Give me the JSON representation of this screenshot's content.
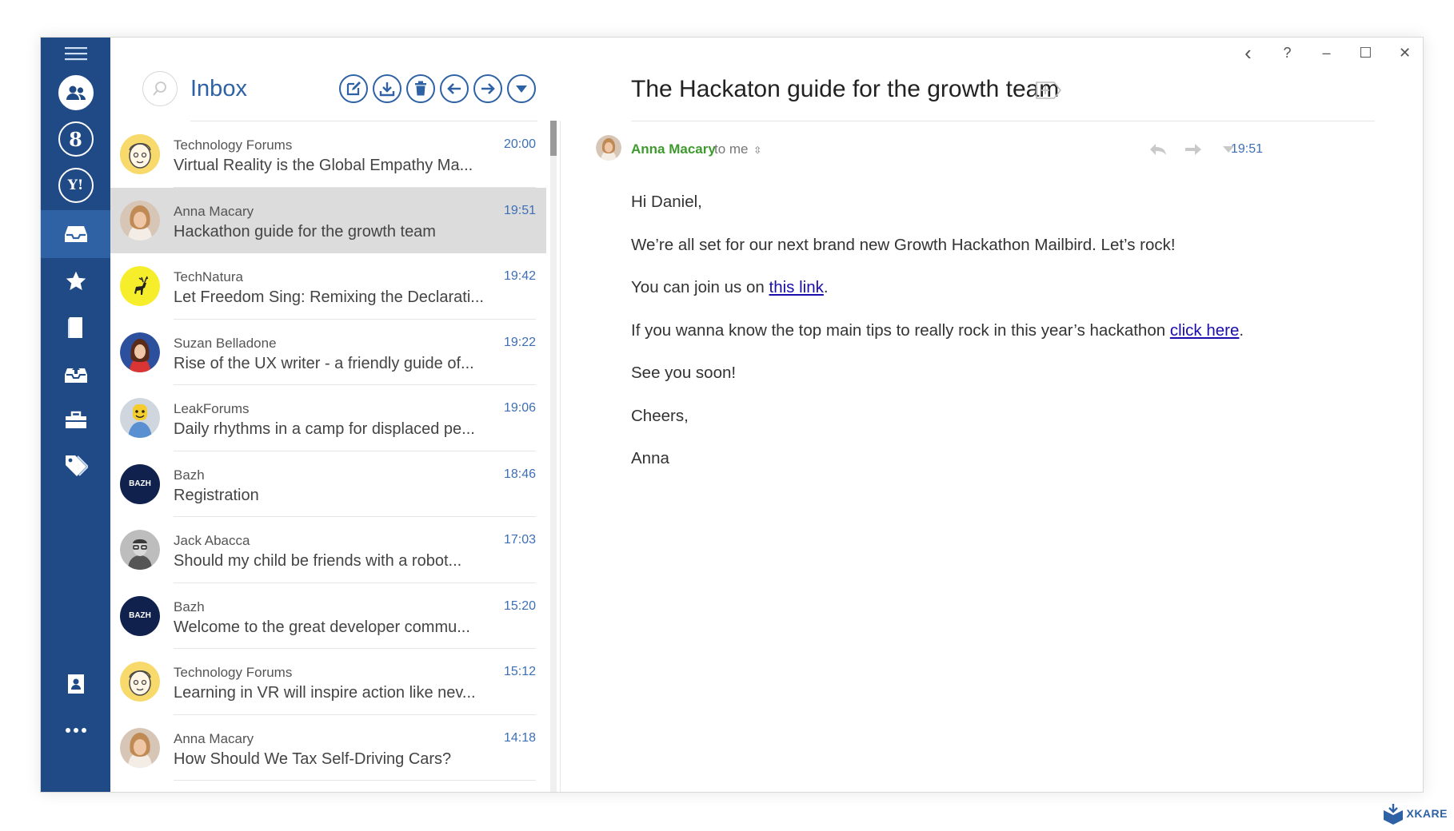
{
  "sidebar": {
    "accounts": [
      {
        "name": "all-accounts",
        "icon": "people-icon"
      },
      {
        "name": "google-account",
        "icon": "google-icon",
        "glyph": "8"
      },
      {
        "name": "yahoo-account",
        "icon": "yahoo-icon",
        "glyph": "Y!"
      }
    ],
    "folders": [
      "inbox",
      "starred",
      "drafts",
      "archive",
      "briefcase",
      "tags"
    ],
    "bottom": [
      "contacts",
      "more"
    ]
  },
  "list": {
    "title": "Inbox",
    "messages": [
      {
        "sender": "Technology Forums",
        "subject": "Virtual Reality is the Global Empathy Ma...",
        "time": "20:00",
        "avatar": "cartoon-face"
      },
      {
        "sender": "Anna Macary",
        "subject": "Hackathon guide for the growth team",
        "time": "19:51",
        "avatar": "woman-photo",
        "selected": true
      },
      {
        "sender": "TechNatura",
        "subject": "Let Freedom Sing: Remixing the Declarati...",
        "time": "19:42",
        "avatar": "deer-logo"
      },
      {
        "sender": "Suzan Belladone",
        "subject": "Rise of the UX writer - a friendly guide of...",
        "time": "19:22",
        "avatar": "woman-blue"
      },
      {
        "sender": "LeakForums",
        "subject": "Daily rhythms in a camp for displaced pe...",
        "time": "19:06",
        "avatar": "lego-figure"
      },
      {
        "sender": "Bazh",
        "subject": "Registration",
        "time": "18:46",
        "avatar": "bazh-logo",
        "avatar_text": "BAZH"
      },
      {
        "sender": "Jack Abacca",
        "subject": "Should my child be friends with a robot...",
        "time": "17:03",
        "avatar": "man-photo"
      },
      {
        "sender": "Bazh",
        "subject": "Welcome to the great developer commu...",
        "time": "15:20",
        "avatar": "bazh-logo",
        "avatar_text": "BAZH"
      },
      {
        "sender": "Technology Forums",
        "subject": "Learning in VR will inspire action like nev...",
        "time": "15:12",
        "avatar": "cartoon-face"
      },
      {
        "sender": "Anna Macary",
        "subject": "How Should We Tax Self-Driving Cars?",
        "time": "14:18",
        "avatar": "woman-photo"
      }
    ]
  },
  "reading": {
    "title": "The Hackaton guide for the growth team",
    "from": "Anna Macary",
    "to": "to me",
    "time": "19:51",
    "body": {
      "greeting": "Hi Daniel,",
      "line1": "We’re all set for our next brand new Growth Hackathon Mailbird. Let’s rock!",
      "line2_pre": "You can join us on ",
      "line2_link": "this link",
      "line2_post": ".",
      "line3_pre": "If you wanna know the top main tips to really rock in this year’s hackathon ",
      "line3_link": "click here",
      "line3_post": ".",
      "line4": "See you soon!",
      "line5": "Cheers,",
      "signature": "Anna"
    }
  },
  "window_controls": {
    "back": "‹",
    "help": "?",
    "minimize": "–",
    "maximize": "☐",
    "close": "✕"
  },
  "watermark": {
    "text": "XKARE"
  },
  "colors": {
    "sidebar": "#1f4a86",
    "accent": "#2f62a5",
    "sender_green": "#3f9a2e",
    "time_blue": "#3d6fb5",
    "selected_row": "#dcdcdc"
  }
}
